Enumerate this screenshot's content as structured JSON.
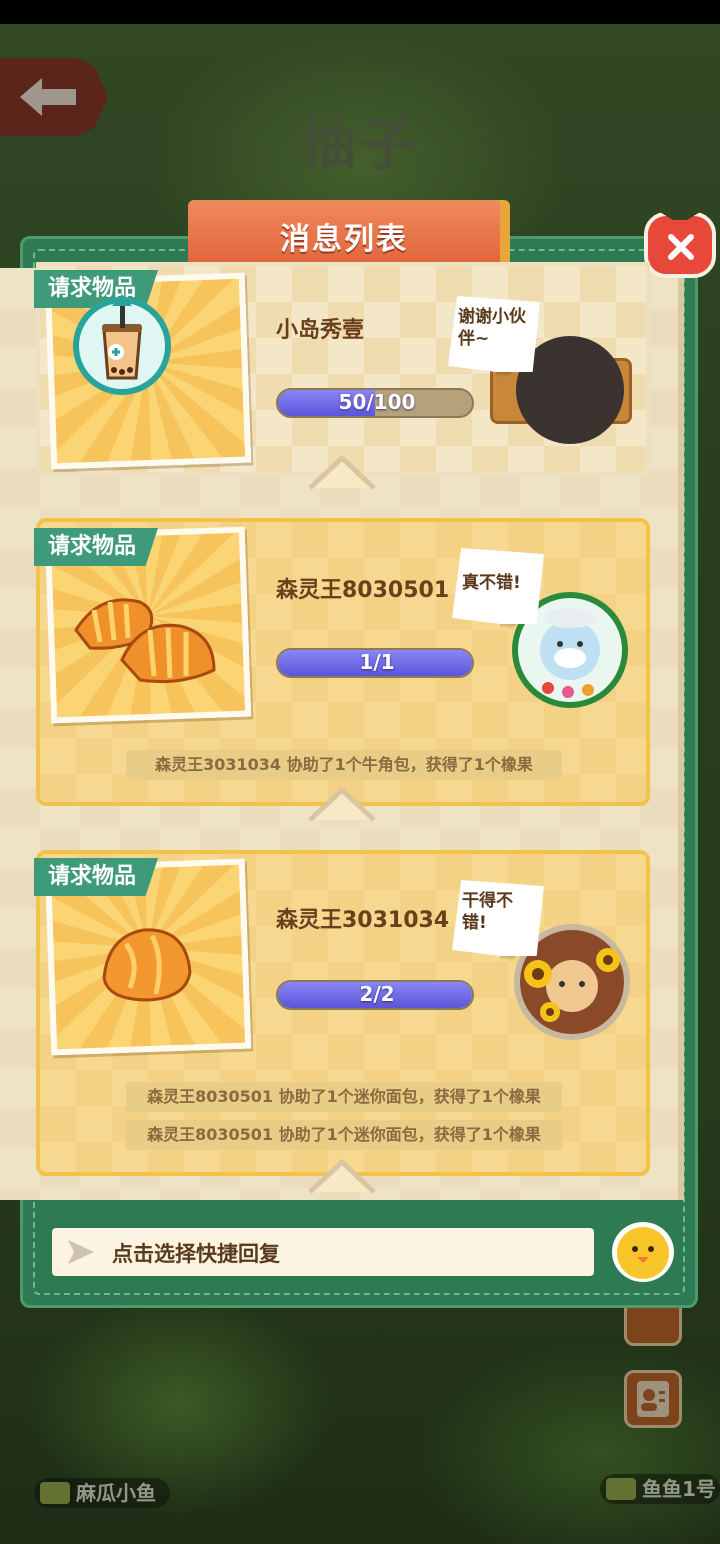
{
  "background": {
    "title": "柚子",
    "bottom_left_label": "麻瓜小鱼",
    "bottom_right_label": "鱼鱼1号"
  },
  "dialog": {
    "title": "消息列表",
    "close_icon": "close-x-icon"
  },
  "cards": [
    {
      "tag": "请求物品",
      "item_icon": "bubble-tea-icon",
      "name": "小岛秀壹",
      "progress_text": "50/100",
      "progress": 0.5,
      "bubble": "谢谢小伙伴~",
      "logs": []
    },
    {
      "tag": "请求物品",
      "item_icon": "croissant-icon",
      "name": "森灵王8030501",
      "progress_text": "1/1",
      "progress": 1.0,
      "bubble": "真不错!",
      "logs": [
        "森灵王3031034  协助了1个牛角包，获得了1个橡果"
      ]
    },
    {
      "tag": "请求物品",
      "item_icon": "mini-bread-icon",
      "name": "森灵王3031034",
      "progress_text": "2/2",
      "progress": 1.0,
      "bubble": "干得不错!",
      "logs": [
        "森灵王8030501  协助了1个迷你面包，获得了1个橡果",
        "森灵王8030501  协助了1个迷你面包，获得了1个橡果"
      ]
    }
  ],
  "reply": {
    "placeholder": "点击选择快捷回复"
  }
}
